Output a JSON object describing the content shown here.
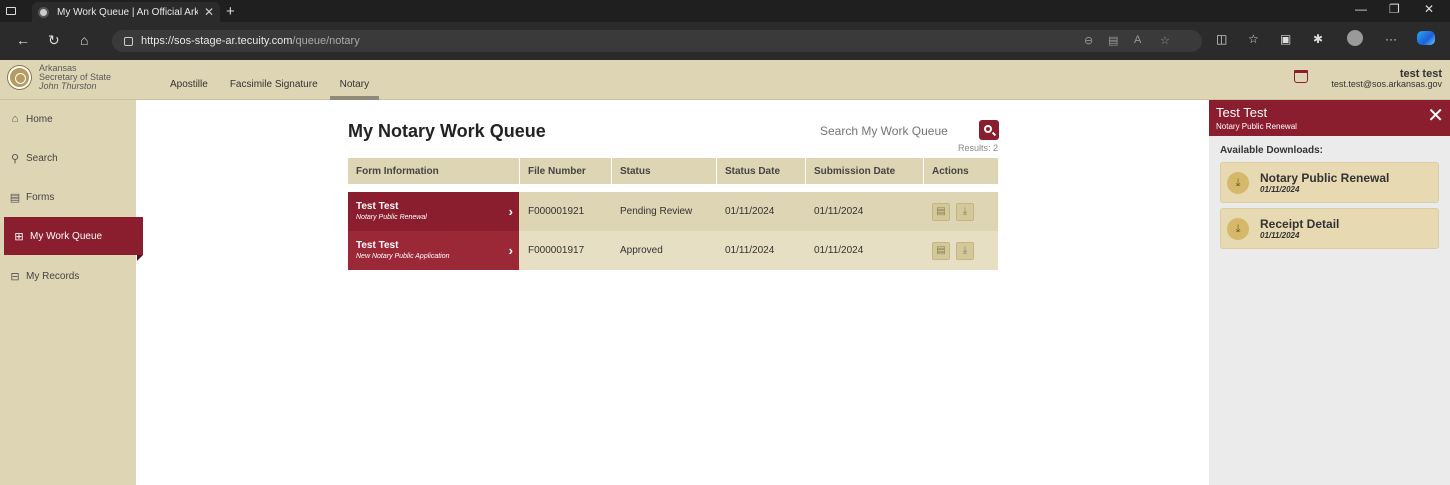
{
  "browser": {
    "tab_title": "My Work Queue | An Official Ark",
    "url_host": "https://sos-stage-ar.tecuity.com",
    "url_path": "/queue/notary"
  },
  "header": {
    "logo_line1": "Arkansas",
    "logo_line2": "Secretary of State",
    "logo_line3": "John Thurston",
    "nav": [
      "Apostille",
      "Facsimile Signature",
      "Notary"
    ],
    "active_nav": "Notary",
    "user_name": "test test",
    "user_email": "test.test@sos.arkansas.gov"
  },
  "sidebar": {
    "items": [
      {
        "label": "Home",
        "icon": "home-icon"
      },
      {
        "label": "Search",
        "icon": "search-icon"
      },
      {
        "label": "Forms",
        "icon": "forms-icon"
      },
      {
        "label": "My Work Queue",
        "icon": "work-queue-icon"
      },
      {
        "label": "My Records",
        "icon": "records-icon"
      }
    ],
    "active": "My Work Queue"
  },
  "main": {
    "title": "My Notary Work Queue",
    "search_placeholder": "Search My Work Queue",
    "results": "Results: 2",
    "columns": [
      "Form Information",
      "File Number",
      "Status",
      "Status Date",
      "Submission Date",
      "Actions"
    ],
    "rows": [
      {
        "name": "Test Test",
        "form_type": "Notary Public Renewal",
        "file_number": "F000001921",
        "status": "Pending Review",
        "status_date": "01/11/2024",
        "submission_date": "01/11/2024"
      },
      {
        "name": "Test Test",
        "form_type": "New Notary Public Application",
        "file_number": "F000001917",
        "status": "Approved",
        "status_date": "01/11/2024",
        "submission_date": "01/11/2024"
      }
    ]
  },
  "panel": {
    "title": "Test Test",
    "subtitle": "Notary Public Renewal",
    "downloads_heading": "Available Downloads:",
    "downloads": [
      {
        "name": "Notary Public Renewal",
        "date": "01/11/2024"
      },
      {
        "name": "Receipt Detail",
        "date": "01/11/2024"
      }
    ]
  },
  "colors": {
    "brand_maroon": "#8b1e2e",
    "sidebar_tan": "#ddd5b3",
    "panel_bg": "#ebebeb"
  }
}
